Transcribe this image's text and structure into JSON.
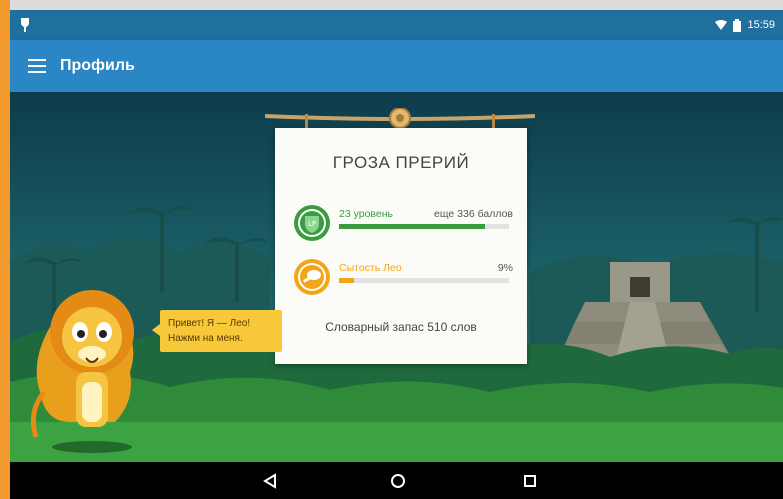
{
  "status_bar": {
    "time": "15:59"
  },
  "app_bar": {
    "title": "Профиль"
  },
  "profile_card": {
    "title": "ГРОЗА ПРЕРИЙ",
    "level": {
      "badge_text": "LP",
      "label": "23 уровень",
      "remaining": "еще 336 баллов",
      "progress_fraction": 0.86,
      "color": "#3a9c3f"
    },
    "satiety": {
      "label": "Сытость Лео",
      "value": "9%",
      "progress_fraction": 0.09,
      "color": "#f2a516"
    },
    "vocabulary": "Словарный запас 510 слов"
  },
  "mascot": {
    "speech_line1": "Привет! Я — Лео!",
    "speech_line2": "Нажми на меня."
  },
  "icons": {
    "menu": "hamburger-menu-icon",
    "back": "back-triangle-icon",
    "home": "home-circle-icon",
    "recents": "recents-square-icon"
  }
}
